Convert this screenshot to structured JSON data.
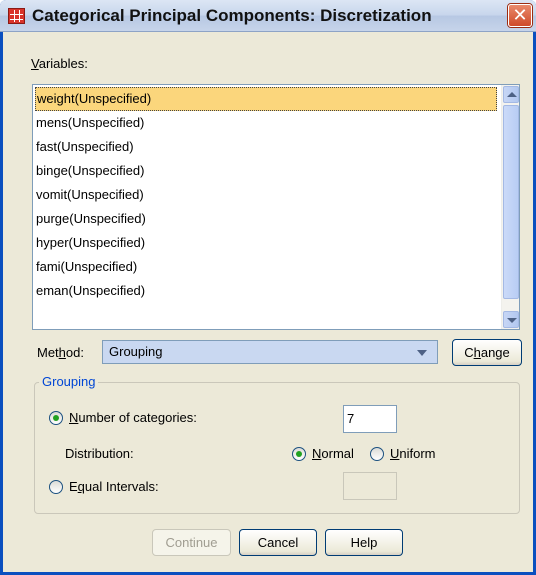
{
  "window": {
    "title": "Categorical Principal Components: Discretization",
    "app_icon": "spss-table-icon",
    "close_label": "✕"
  },
  "variables": {
    "label": "Variables:",
    "items": [
      "weight(Unspecified)",
      "mens(Unspecified)",
      "fast(Unspecified)",
      "binge(Unspecified)",
      "vomit(Unspecified)",
      "purge(Unspecified)",
      "hyper(Unspecified)",
      "fami(Unspecified)",
      "eman(Unspecified)"
    ],
    "selected_index": 0
  },
  "method": {
    "label": "Method:",
    "value": "Grouping",
    "change_button": "Change"
  },
  "grouping": {
    "legend": "Grouping",
    "number_of_categories_label": "Number of categories:",
    "number_of_categories_value": "7",
    "distribution_label": "Distribution:",
    "normal_label": "Normal",
    "uniform_label": "Uniform",
    "equal_intervals_label": "Equal Intervals:",
    "equal_intervals_value": ""
  },
  "buttons": {
    "continue": "Continue",
    "cancel": "Cancel",
    "help": "Help"
  },
  "colors": {
    "selection": "#fbd67c",
    "group_legend": "#0046d5",
    "window_face": "#ece9d8"
  }
}
